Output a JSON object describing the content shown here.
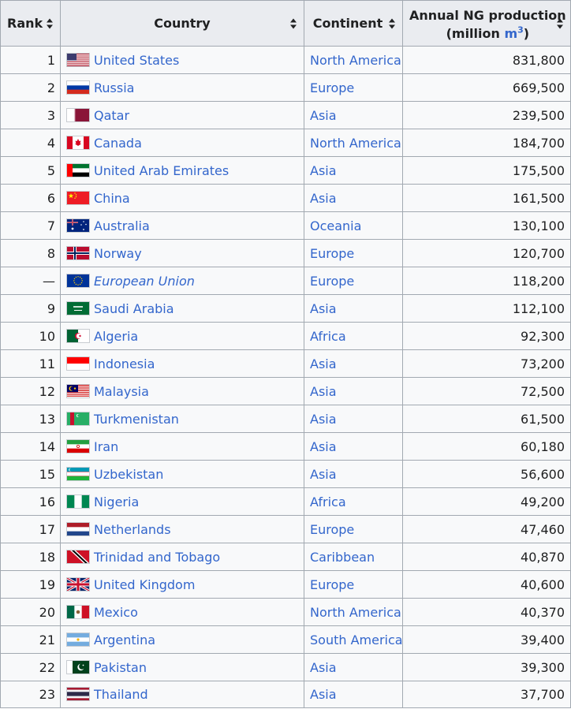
{
  "headers": {
    "rank": "Rank",
    "country": "Country",
    "continent": "Continent",
    "prod_line1": "Annual NG production",
    "prod_pre": "(million ",
    "prod_unit": "m",
    "prod_sup": "3",
    "prod_post": ")"
  },
  "rows": [
    {
      "rank": "1",
      "country": "United States",
      "continent": "North America",
      "prod": "831,800",
      "flag": "us-flag"
    },
    {
      "rank": "2",
      "country": "Russia",
      "continent": "Europe",
      "prod": "669,500",
      "flag": "russia-flag"
    },
    {
      "rank": "3",
      "country": "Qatar",
      "continent": "Asia",
      "prod": "239,500",
      "flag": "qatar-flag"
    },
    {
      "rank": "4",
      "country": "Canada",
      "continent": "North America",
      "prod": "184,700",
      "flag": "canada-flag"
    },
    {
      "rank": "5",
      "country": "United Arab Emirates",
      "continent": "Asia",
      "prod": "175,500",
      "flag": "uae-flag"
    },
    {
      "rank": "6",
      "country": "China",
      "continent": "Asia",
      "prod": "161,500",
      "flag": "china-flag"
    },
    {
      "rank": "7",
      "country": "Australia",
      "continent": "Oceania",
      "prod": "130,100",
      "flag": "australia-flag"
    },
    {
      "rank": "8",
      "country": "Norway",
      "continent": "Europe",
      "prod": "120,700",
      "flag": "norway-flag"
    },
    {
      "rank": "—",
      "country": "European Union",
      "continent": "Europe",
      "prod": "118,200",
      "flag": "eu-flag",
      "italic": true
    },
    {
      "rank": "9",
      "country": "Saudi Arabia",
      "continent": "Asia",
      "prod": "112,100",
      "flag": "saudi-flag"
    },
    {
      "rank": "10",
      "country": "Algeria",
      "continent": "Africa",
      "prod": "92,300",
      "flag": "algeria-flag"
    },
    {
      "rank": "11",
      "country": "Indonesia",
      "continent": "Asia",
      "prod": "73,200",
      "flag": "indonesia-flag"
    },
    {
      "rank": "12",
      "country": "Malaysia",
      "continent": "Asia",
      "prod": "72,500",
      "flag": "malaysia-flag"
    },
    {
      "rank": "13",
      "country": "Turkmenistan",
      "continent": "Asia",
      "prod": "61,500",
      "flag": "turkmenistan-flag"
    },
    {
      "rank": "14",
      "country": "Iran",
      "continent": "Asia",
      "prod": "60,180",
      "flag": "iran-flag"
    },
    {
      "rank": "15",
      "country": "Uzbekistan",
      "continent": "Asia",
      "prod": "56,600",
      "flag": "uzbekistan-flag"
    },
    {
      "rank": "16",
      "country": "Nigeria",
      "continent": "Africa",
      "prod": "49,200",
      "flag": "nigeria-flag"
    },
    {
      "rank": "17",
      "country": "Netherlands",
      "continent": "Europe",
      "prod": "47,460",
      "flag": "netherlands-flag"
    },
    {
      "rank": "18",
      "country": "Trinidad and Tobago",
      "continent": "Caribbean",
      "prod": "40,870",
      "flag": "trinidad-flag"
    },
    {
      "rank": "19",
      "country": "United Kingdom",
      "continent": "Europe",
      "prod": "40,600",
      "flag": "uk-flag"
    },
    {
      "rank": "20",
      "country": "Mexico",
      "continent": "North America",
      "prod": "40,370",
      "flag": "mexico-flag"
    },
    {
      "rank": "21",
      "country": "Argentina",
      "continent": "South America",
      "prod": "39,400",
      "flag": "argentina-flag"
    },
    {
      "rank": "22",
      "country": "Pakistan",
      "continent": "Asia",
      "prod": "39,300",
      "flag": "pakistan-flag"
    },
    {
      "rank": "23",
      "country": "Thailand",
      "continent": "Asia",
      "prod": "37,700",
      "flag": "thailand-flag"
    }
  ],
  "colors": {
    "link": "#3366cc",
    "header_bg": "#eaecf0",
    "cell_bg": "#f8f9fa",
    "border": "#a2a9b1"
  }
}
